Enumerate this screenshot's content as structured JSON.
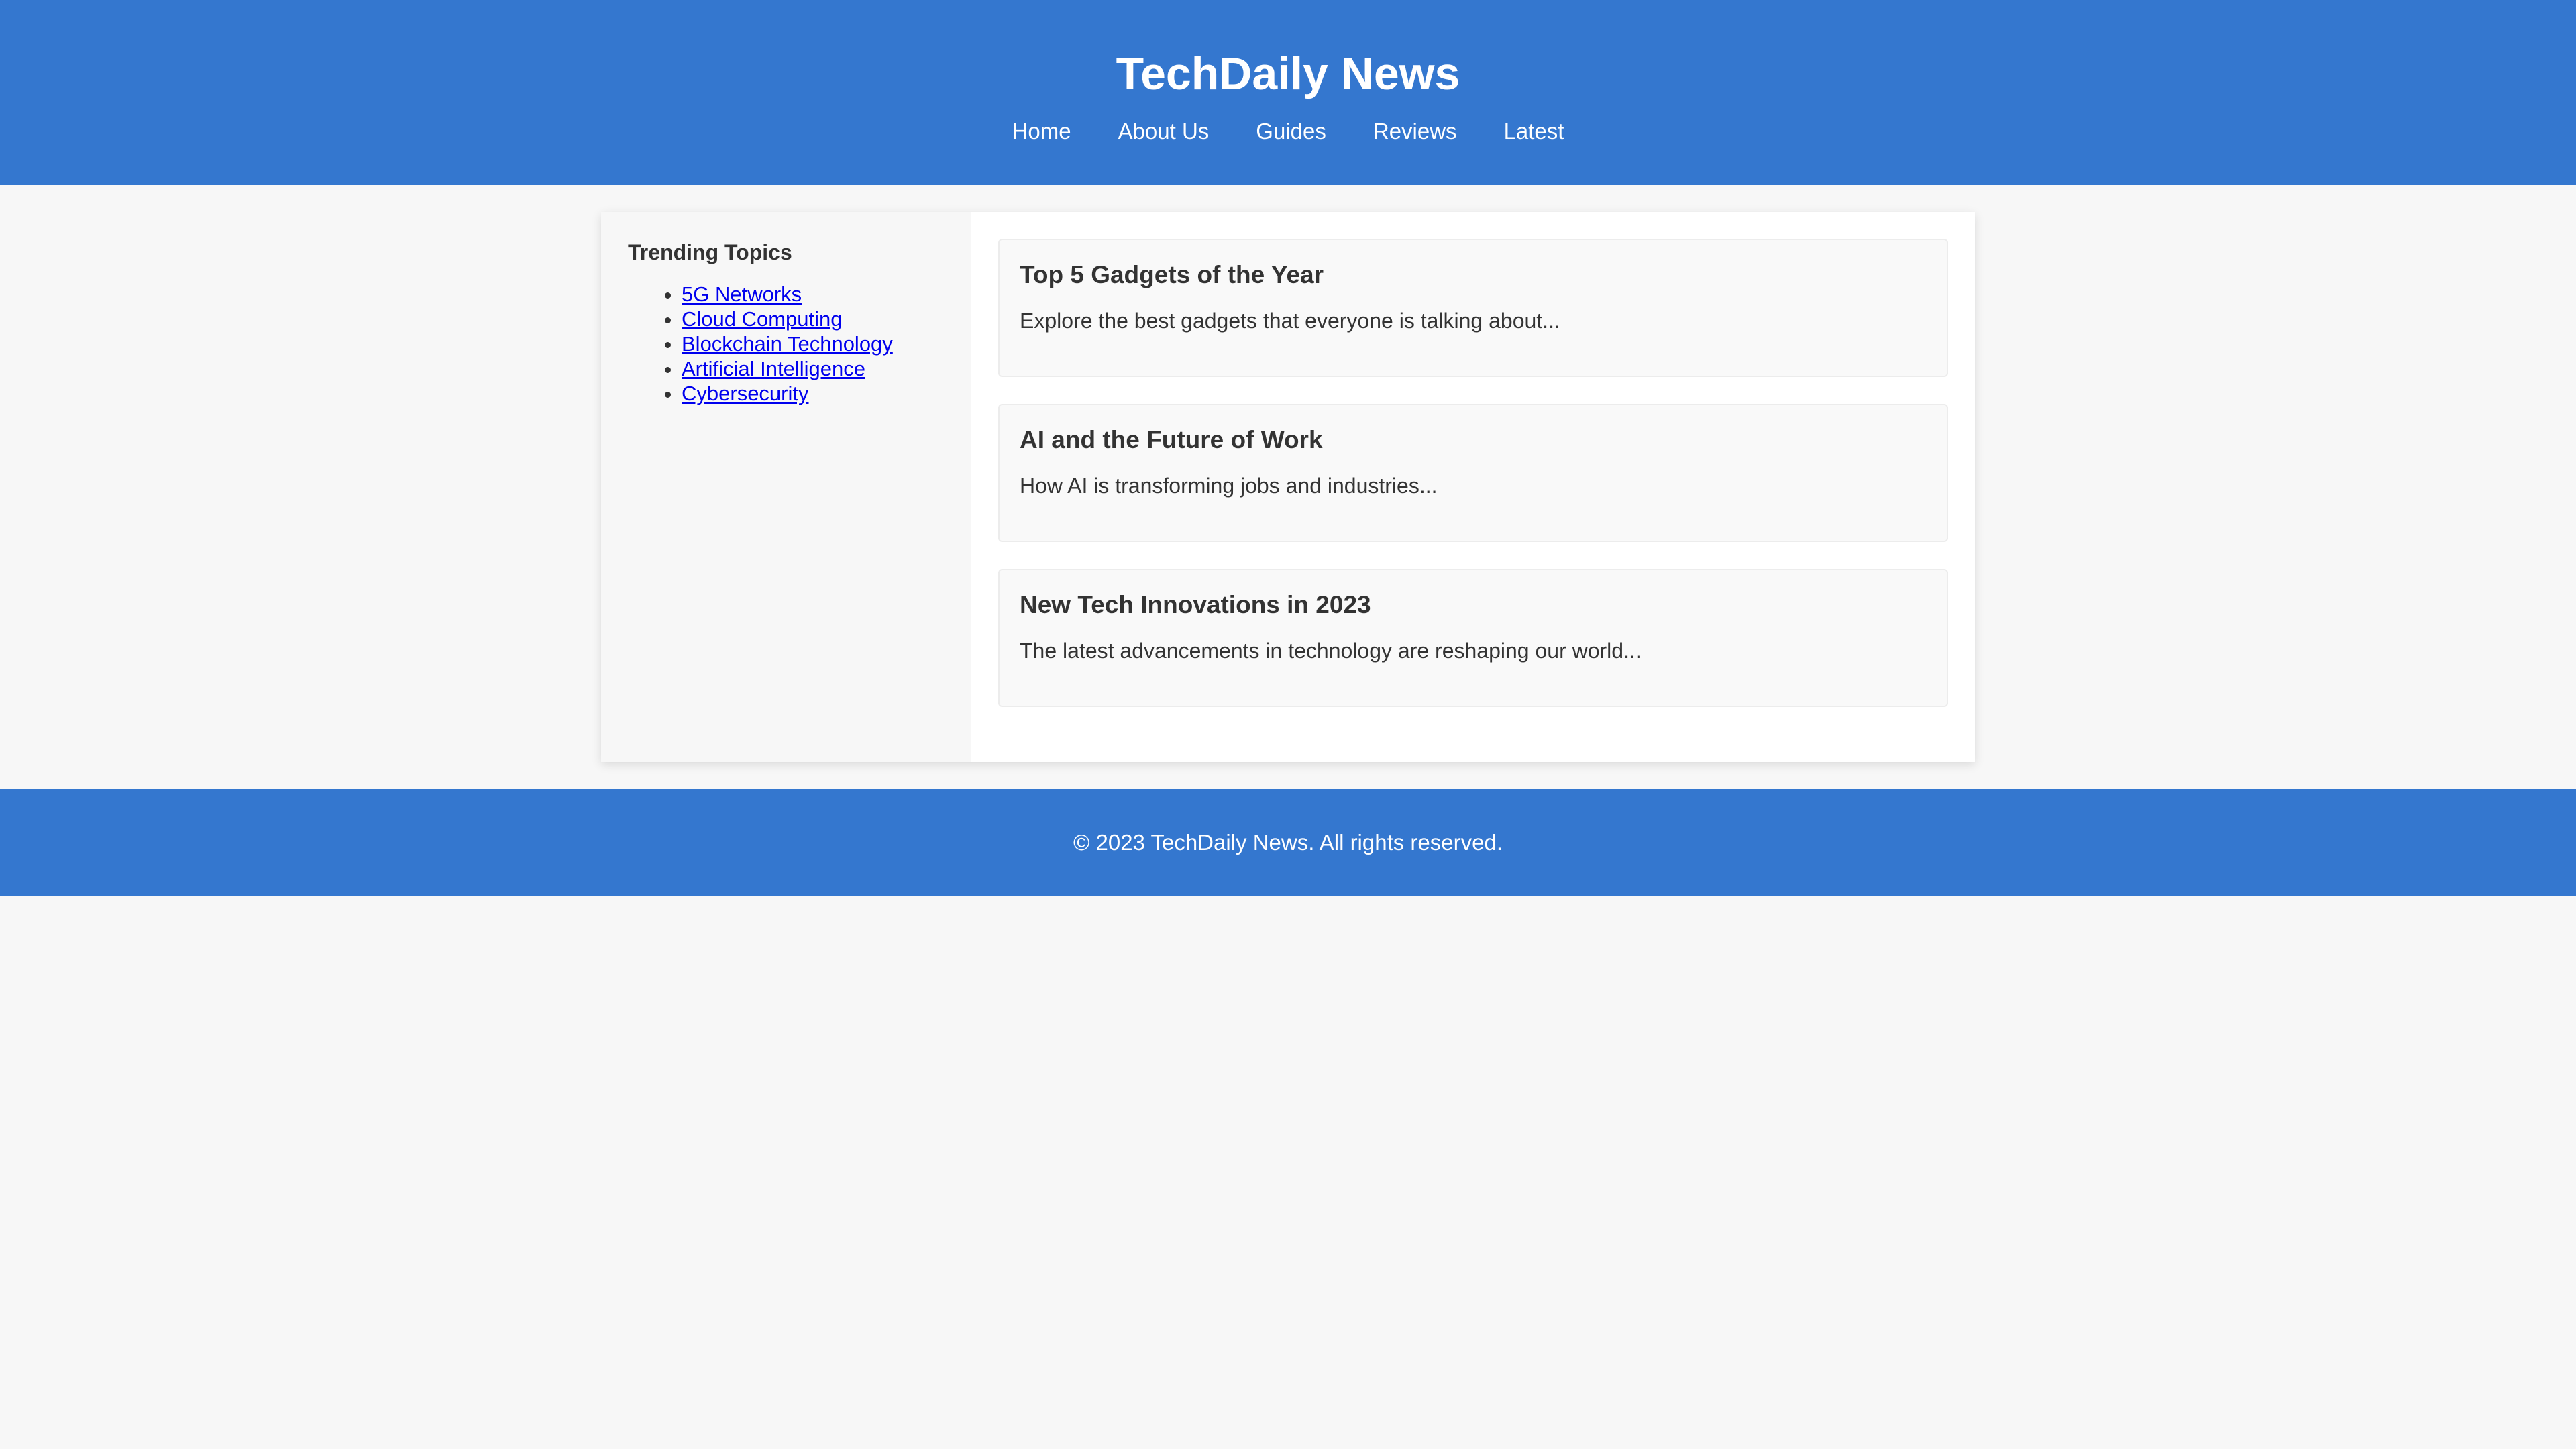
{
  "header": {
    "title": "TechDaily News",
    "nav": [
      {
        "label": "Home"
      },
      {
        "label": "About Us"
      },
      {
        "label": "Guides"
      },
      {
        "label": "Reviews"
      },
      {
        "label": "Latest"
      }
    ]
  },
  "sidebar": {
    "title": "Trending Topics",
    "topics": [
      {
        "label": "5G Networks"
      },
      {
        "label": "Cloud Computing"
      },
      {
        "label": "Blockchain Technology"
      },
      {
        "label": "Artificial Intelligence"
      },
      {
        "label": "Cybersecurity"
      }
    ]
  },
  "articles": [
    {
      "title": "Top 5 Gadgets of the Year",
      "summary": "Explore the best gadgets that everyone is talking about..."
    },
    {
      "title": "AI and the Future of Work",
      "summary": "How AI is transforming jobs and industries..."
    },
    {
      "title": "New Tech Innovations in 2023",
      "summary": "The latest advancements in technology are reshaping our world..."
    }
  ],
  "footer": {
    "text": "© 2023 TechDaily News. All rights reserved."
  },
  "colors": {
    "brand": "#3477cf",
    "background": "#f7f7f7",
    "link": "#0000ee"
  }
}
